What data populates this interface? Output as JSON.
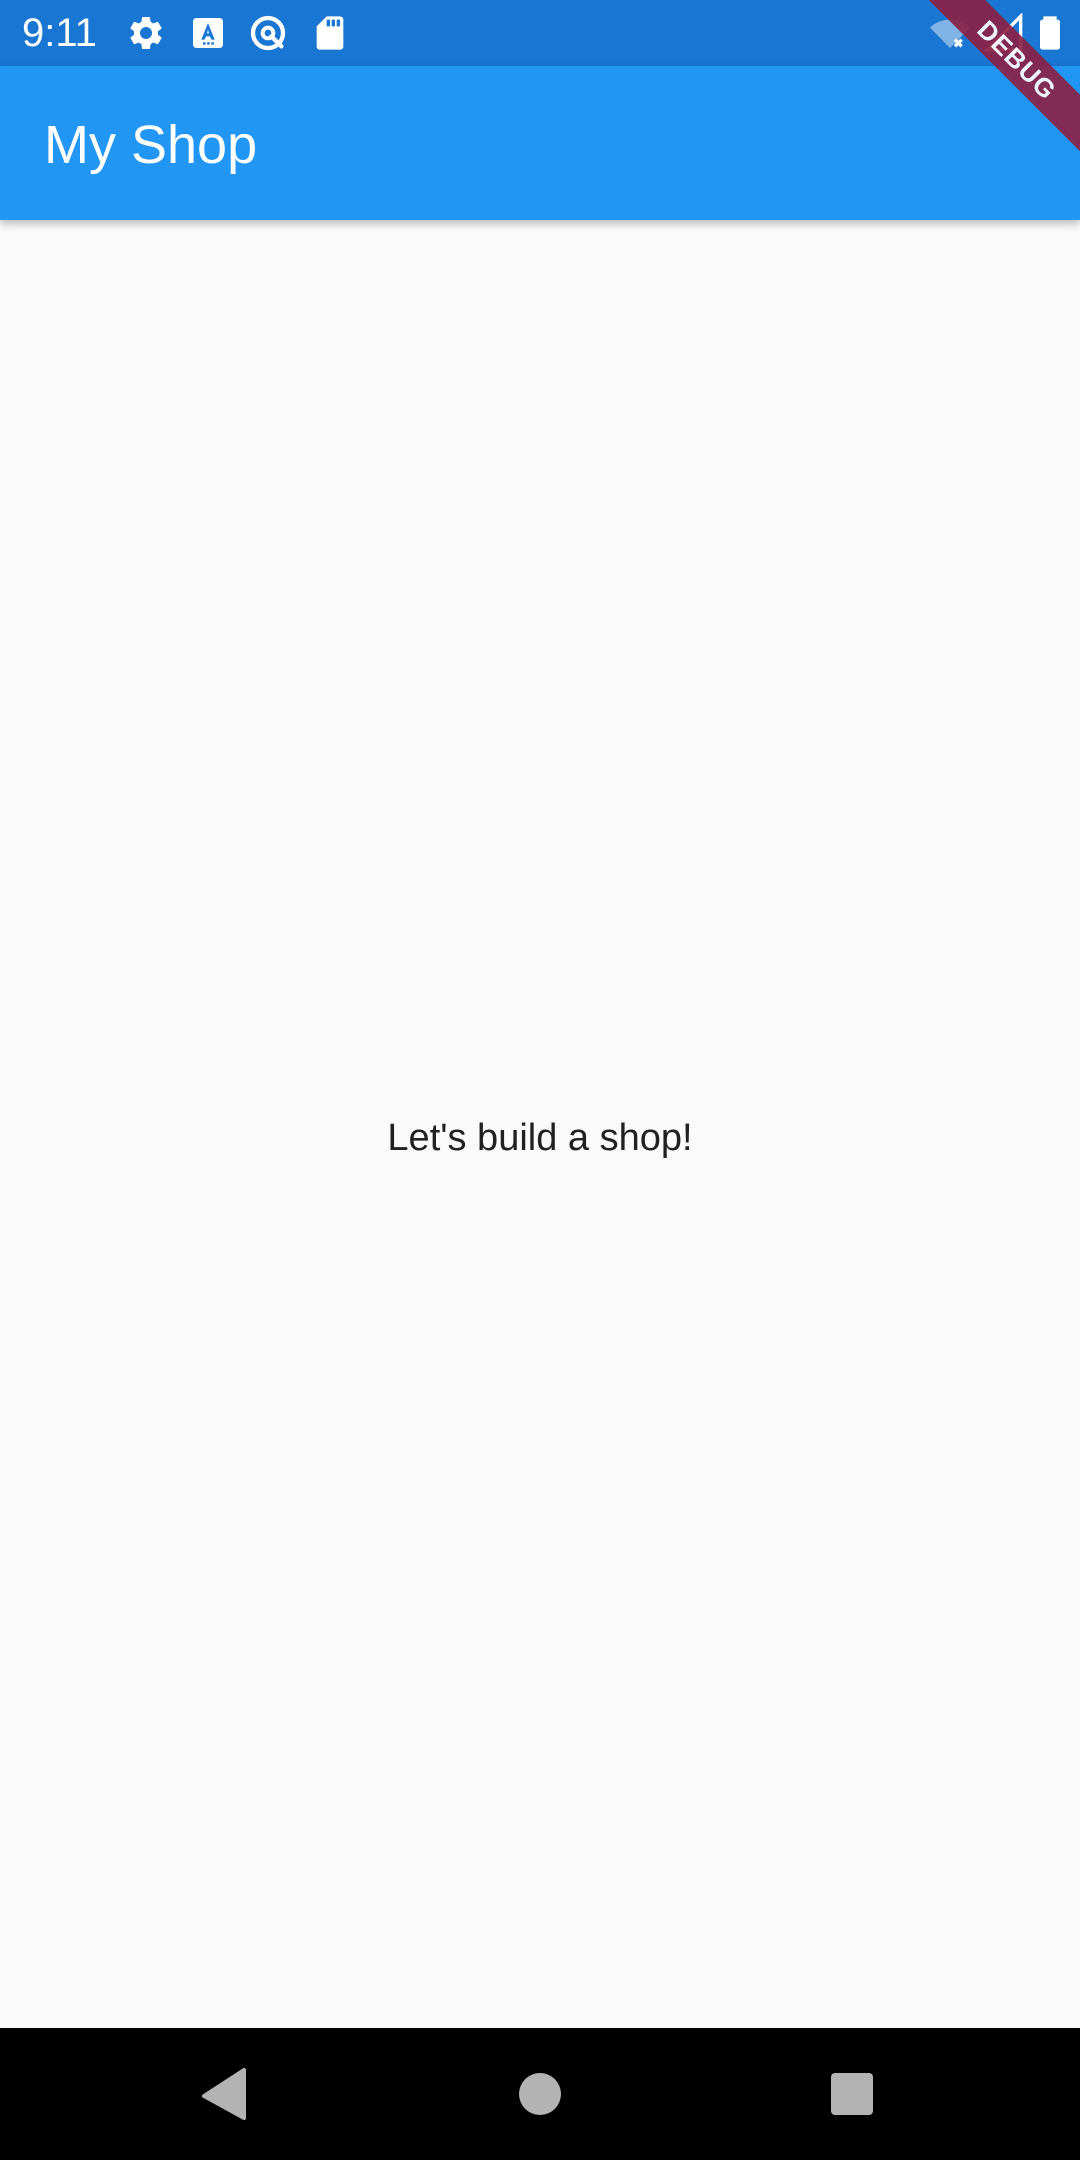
{
  "status_bar": {
    "time": "9:11",
    "icons": [
      "gear-icon",
      "font-a-icon",
      "location-q-icon",
      "sd-card-icon",
      "wifi-off-icon",
      "signal-icon",
      "battery-icon"
    ],
    "background_color": "#1976d2"
  },
  "app_bar": {
    "title": "My Shop",
    "background_color": "#2196f3"
  },
  "body": {
    "message": "Let's build a shop!",
    "background_color": "#fafafa"
  },
  "debug_banner": {
    "label": "DEBUG",
    "color": "#8b2246"
  },
  "nav_bar": {
    "buttons": [
      "back-icon",
      "home-icon",
      "recents-icon"
    ],
    "background_color": "#000000"
  }
}
